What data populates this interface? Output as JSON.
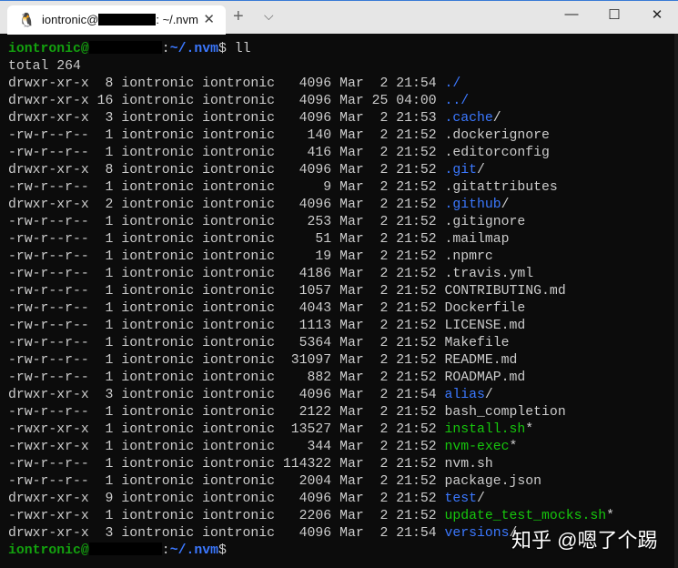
{
  "tab": {
    "title_prefix": "iontronic@",
    "title_suffix": ": ~/.nvm",
    "icon": "linux-penguin-icon"
  },
  "window": {
    "new_tab": "+",
    "dropdown": "⌵",
    "minimize": "—",
    "maximize": "☐",
    "close": "✕",
    "tab_close": "✕"
  },
  "prompt": {
    "user": "iontronic@",
    "sep": ":",
    "path": "~/.nvm",
    "dollar": "$ ",
    "command": "ll"
  },
  "total": "total 264",
  "entries": [
    [
      "drwxr-xr-x",
      "8",
      "iontronic",
      "iontronic",
      "4096",
      "Mar",
      "2",
      "21:54",
      "./",
      "dir"
    ],
    [
      "drwxr-xr-x",
      "16",
      "iontronic",
      "iontronic",
      "4096",
      "Mar",
      "25",
      "04:00",
      "../",
      "dir"
    ],
    [
      "drwxr-xr-x",
      "3",
      "iontronic",
      "iontronic",
      "4096",
      "Mar",
      "2",
      "21:53",
      ".cache",
      "dir"
    ],
    [
      "-rw-r--r--",
      "1",
      "iontronic",
      "iontronic",
      "140",
      "Mar",
      "2",
      "21:52",
      ".dockerignore",
      "file"
    ],
    [
      "-rw-r--r--",
      "1",
      "iontronic",
      "iontronic",
      "416",
      "Mar",
      "2",
      "21:52",
      ".editorconfig",
      "file"
    ],
    [
      "drwxr-xr-x",
      "8",
      "iontronic",
      "iontronic",
      "4096",
      "Mar",
      "2",
      "21:52",
      ".git",
      "dir"
    ],
    [
      "-rw-r--r--",
      "1",
      "iontronic",
      "iontronic",
      "9",
      "Mar",
      "2",
      "21:52",
      ".gitattributes",
      "file"
    ],
    [
      "drwxr-xr-x",
      "2",
      "iontronic",
      "iontronic",
      "4096",
      "Mar",
      "2",
      "21:52",
      ".github",
      "dir"
    ],
    [
      "-rw-r--r--",
      "1",
      "iontronic",
      "iontronic",
      "253",
      "Mar",
      "2",
      "21:52",
      ".gitignore",
      "file"
    ],
    [
      "-rw-r--r--",
      "1",
      "iontronic",
      "iontronic",
      "51",
      "Mar",
      "2",
      "21:52",
      ".mailmap",
      "file"
    ],
    [
      "-rw-r--r--",
      "1",
      "iontronic",
      "iontronic",
      "19",
      "Mar",
      "2",
      "21:52",
      ".npmrc",
      "file"
    ],
    [
      "-rw-r--r--",
      "1",
      "iontronic",
      "iontronic",
      "4186",
      "Mar",
      "2",
      "21:52",
      ".travis.yml",
      "file"
    ],
    [
      "-rw-r--r--",
      "1",
      "iontronic",
      "iontronic",
      "1057",
      "Mar",
      "2",
      "21:52",
      "CONTRIBUTING.md",
      "file"
    ],
    [
      "-rw-r--r--",
      "1",
      "iontronic",
      "iontronic",
      "4043",
      "Mar",
      "2",
      "21:52",
      "Dockerfile",
      "file"
    ],
    [
      "-rw-r--r--",
      "1",
      "iontronic",
      "iontronic",
      "1113",
      "Mar",
      "2",
      "21:52",
      "LICENSE.md",
      "file"
    ],
    [
      "-rw-r--r--",
      "1",
      "iontronic",
      "iontronic",
      "5364",
      "Mar",
      "2",
      "21:52",
      "Makefile",
      "file"
    ],
    [
      "-rw-r--r--",
      "1",
      "iontronic",
      "iontronic",
      "31097",
      "Mar",
      "2",
      "21:52",
      "README.md",
      "file"
    ],
    [
      "-rw-r--r--",
      "1",
      "iontronic",
      "iontronic",
      "882",
      "Mar",
      "2",
      "21:52",
      "ROADMAP.md",
      "file"
    ],
    [
      "drwxr-xr-x",
      "3",
      "iontronic",
      "iontronic",
      "4096",
      "Mar",
      "2",
      "21:54",
      "alias",
      "dir"
    ],
    [
      "-rw-r--r--",
      "1",
      "iontronic",
      "iontronic",
      "2122",
      "Mar",
      "2",
      "21:52",
      "bash_completion",
      "file"
    ],
    [
      "-rwxr-xr-x",
      "1",
      "iontronic",
      "iontronic",
      "13527",
      "Mar",
      "2",
      "21:52",
      "install.sh",
      "exec"
    ],
    [
      "-rwxr-xr-x",
      "1",
      "iontronic",
      "iontronic",
      "344",
      "Mar",
      "2",
      "21:52",
      "nvm-exec",
      "exec"
    ],
    [
      "-rw-r--r--",
      "1",
      "iontronic",
      "iontronic",
      "114322",
      "Mar",
      "2",
      "21:52",
      "nvm.sh",
      "file"
    ],
    [
      "-rw-r--r--",
      "1",
      "iontronic",
      "iontronic",
      "2004",
      "Mar",
      "2",
      "21:52",
      "package.json",
      "file"
    ],
    [
      "drwxr-xr-x",
      "9",
      "iontronic",
      "iontronic",
      "4096",
      "Mar",
      "2",
      "21:52",
      "test",
      "dir"
    ],
    [
      "-rwxr-xr-x",
      "1",
      "iontronic",
      "iontronic",
      "2206",
      "Mar",
      "2",
      "21:52",
      "update_test_mocks.sh",
      "exec"
    ],
    [
      "drwxr-xr-x",
      "3",
      "iontronic",
      "iontronic",
      "4096",
      "Mar",
      "2",
      "21:54",
      "versions",
      "dir"
    ]
  ],
  "watermark": "知乎 @嗯了个踢"
}
